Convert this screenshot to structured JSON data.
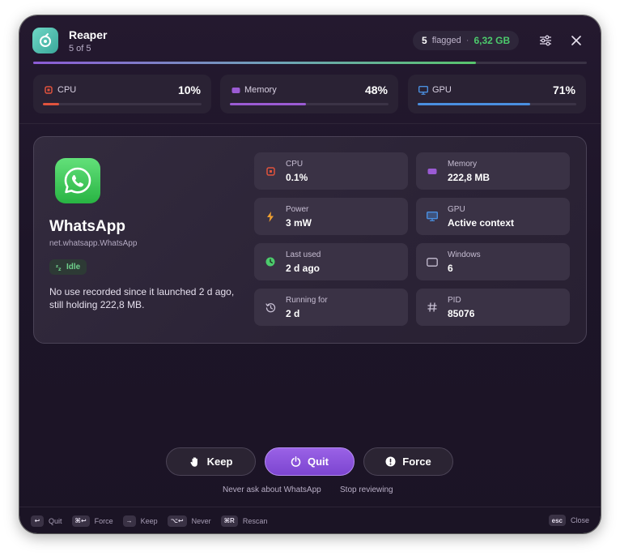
{
  "header": {
    "title": "Reaper",
    "subtitle": "5 of 5",
    "flagged_count": "5",
    "flagged_label": "flagged",
    "separator": "·",
    "flagged_size": "6,32 GB",
    "review_progress": 0.8
  },
  "resources": [
    {
      "label": "CPU",
      "value": "10%",
      "fraction": 0.1,
      "color": "#e0533d",
      "icon": "cpu-chip-icon"
    },
    {
      "label": "Memory",
      "value": "48%",
      "fraction": 0.48,
      "color": "#9b5bd4",
      "icon": "memory-icon"
    },
    {
      "label": "GPU",
      "value": "71%",
      "fraction": 0.71,
      "color": "#4a8fe0",
      "icon": "display-icon"
    }
  ],
  "process": {
    "name": "WhatsApp",
    "bundle_id": "net.whatsapp.WhatsApp",
    "status": "Idle",
    "description": "No use recorded since it launched 2 d ago, still holding 222,8 MB.",
    "stats": [
      {
        "label": "CPU",
        "value": "0.1%",
        "icon": "cpu-chip-icon",
        "color": "#e0533d"
      },
      {
        "label": "Memory",
        "value": "222,8 MB",
        "icon": "memory-icon",
        "color": "#9b5bd4"
      },
      {
        "label": "Power",
        "value": "3 mW",
        "icon": "bolt-icon",
        "color": "#f0a030"
      },
      {
        "label": "GPU",
        "value": "Active context",
        "icon": "display-icon",
        "color": "#4a8fe0"
      },
      {
        "label": "Last used",
        "value": "2 d ago",
        "icon": "clock-icon",
        "color": "#4ccb6c"
      },
      {
        "label": "Windows",
        "value": "6",
        "icon": "window-icon",
        "color": "#c8c0d4"
      },
      {
        "label": "Running for",
        "value": "2 d",
        "icon": "history-icon",
        "color": "#c8c0d4"
      },
      {
        "label": "PID",
        "value": "85076",
        "icon": "hash-icon",
        "color": "#c8c0d4"
      }
    ]
  },
  "actions": {
    "keep": "Keep",
    "quit": "Quit",
    "force": "Force",
    "never_ask": "Never ask about WhatsApp",
    "stop_reviewing": "Stop reviewing"
  },
  "footer": {
    "shortcuts": [
      {
        "key": "↩",
        "label": "Quit"
      },
      {
        "key": "⌘↩",
        "label": "Force"
      },
      {
        "key": "→",
        "label": "Keep"
      },
      {
        "key": "⌥↩",
        "label": "Never"
      },
      {
        "key": "⌘R",
        "label": "Rescan"
      }
    ],
    "close_key": "esc",
    "close_label": "Close"
  }
}
